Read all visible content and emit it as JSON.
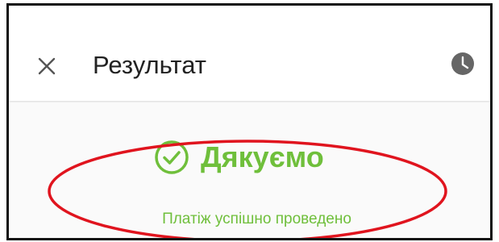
{
  "header": {
    "title": "Результат",
    "close_icon": "close-icon",
    "history_icon": "clock-icon"
  },
  "result": {
    "heading": "Дякуємо",
    "message": "Платіж успішно проведено",
    "status_icon": "check-circle-icon"
  },
  "colors": {
    "success": "#6fbf3b",
    "highlight": "#e0141e",
    "icon_gray": "#666666"
  }
}
